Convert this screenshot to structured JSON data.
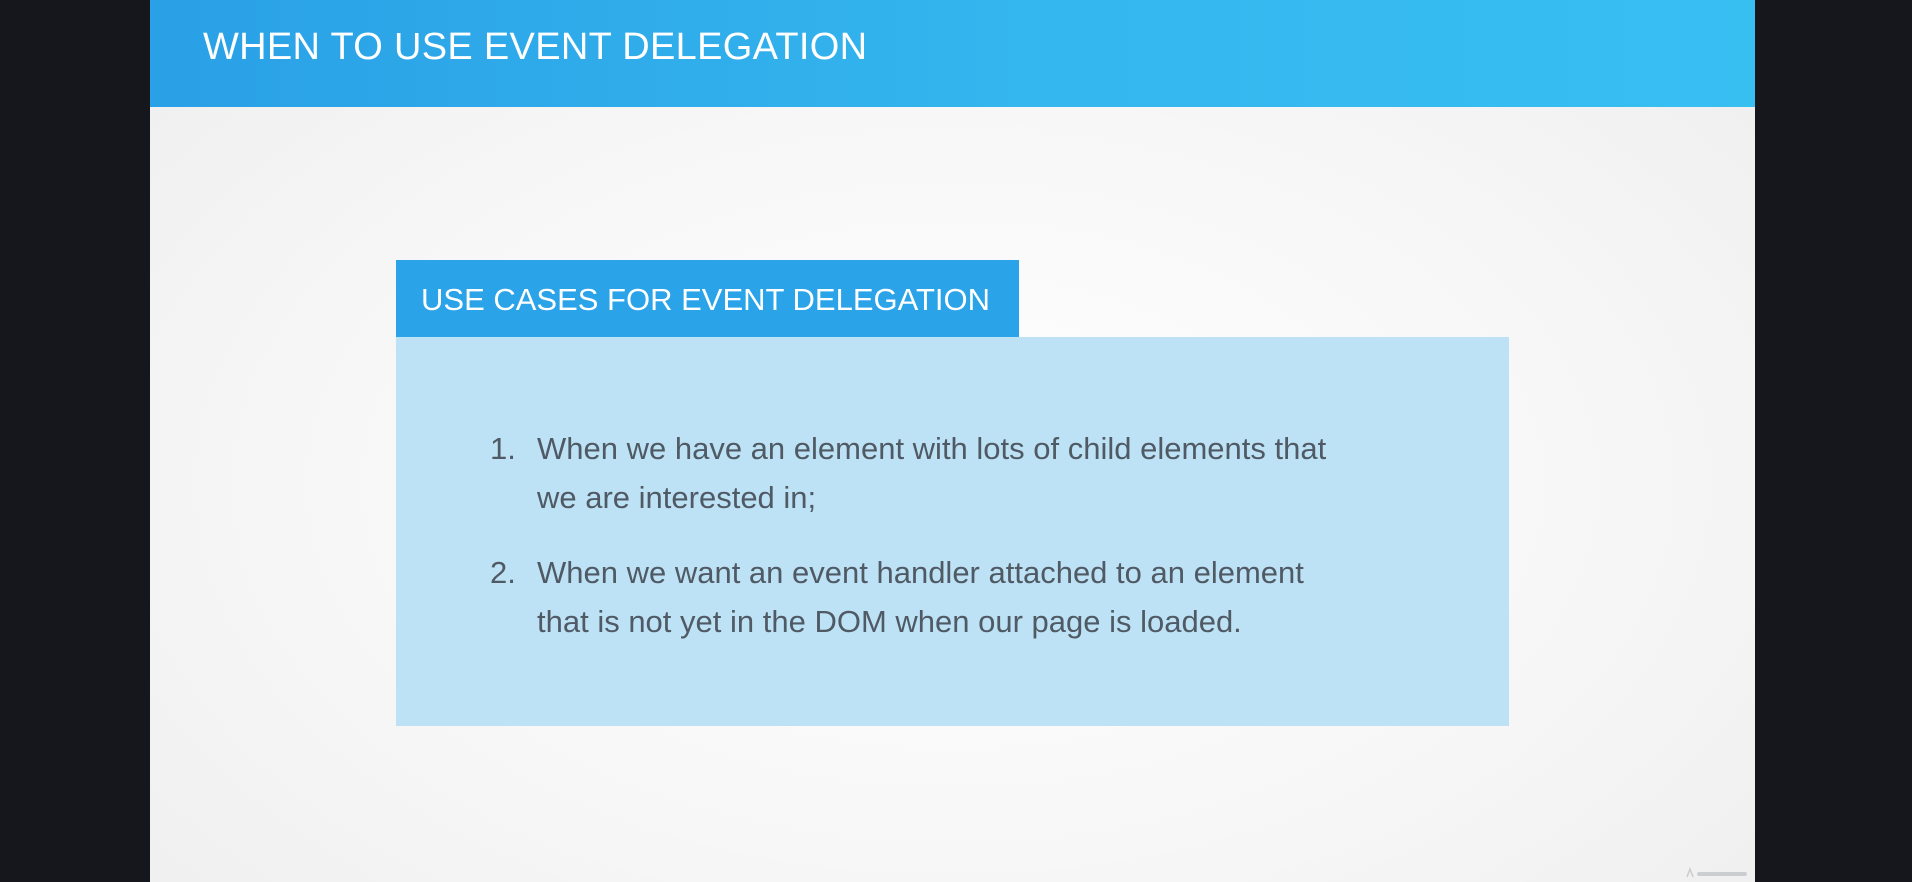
{
  "slide": {
    "title": "WHEN TO USE EVENT DELEGATION",
    "colors": {
      "header": "#34b6ee",
      "tab": "#2aa3e8",
      "box": "#bde2f6",
      "text": "#505a64",
      "frame": "#15171c"
    }
  },
  "box": {
    "heading": "USE CASES FOR EVENT DELEGATION",
    "items": [
      {
        "number": "1.",
        "lines": [
          "When we have an element with lots of child elements that",
          "we are interested in;"
        ]
      },
      {
        "number": "2.",
        "lines": [
          "When we want an event handler attached to an element",
          "that is not yet in the DOM when our page is loaded."
        ]
      }
    ]
  },
  "watermark": {
    "icon": "udemy-logo-icon"
  }
}
